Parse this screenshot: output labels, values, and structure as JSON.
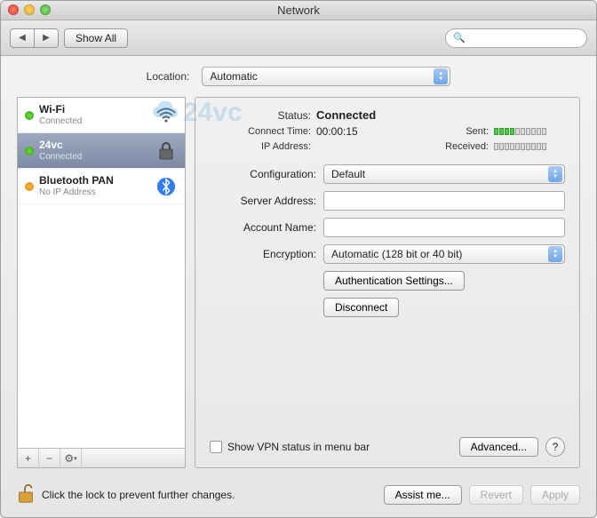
{
  "window": {
    "title": "Network"
  },
  "toolbar": {
    "show_all": "Show All",
    "search_placeholder": ""
  },
  "location": {
    "label": "Location:",
    "value": "Automatic"
  },
  "sidebar": {
    "items": [
      {
        "name": "Wi-Fi",
        "status": "Connected",
        "status_color": "green",
        "icon": "wifi"
      },
      {
        "name": "24vc",
        "status": "Connected",
        "status_color": "green",
        "icon": "lock"
      },
      {
        "name": "Bluetooth PAN",
        "status": "No IP Address",
        "status_color": "orange",
        "icon": "bluetooth"
      }
    ],
    "footer": {
      "add": "+",
      "remove": "−",
      "gear": "⚙"
    }
  },
  "details": {
    "status_label": "Status:",
    "status_value": "Connected",
    "connect_time_label": "Connect Time:",
    "connect_time_value": "00:00:15",
    "ip_label": "IP Address:",
    "ip_value": "",
    "sent_label": "Sent:",
    "sent_bars": 4,
    "received_label": "Received:",
    "received_bars": 0,
    "config_label": "Configuration:",
    "config_value": "Default",
    "server_label": "Server Address:",
    "server_value": "",
    "account_label": "Account Name:",
    "account_value": "",
    "encryption_label": "Encryption:",
    "encryption_value": "Automatic (128 bit or 40 bit)",
    "auth_settings_btn": "Authentication Settings...",
    "disconnect_btn": "Disconnect",
    "show_vpn_checkbox": "Show VPN status in menu bar",
    "advanced_btn": "Advanced...",
    "help": "?"
  },
  "bottom": {
    "lock_text": "Click the lock to prevent further changes.",
    "assist_btn": "Assist me...",
    "revert_btn": "Revert",
    "apply_btn": "Apply"
  },
  "watermark": "24vc"
}
